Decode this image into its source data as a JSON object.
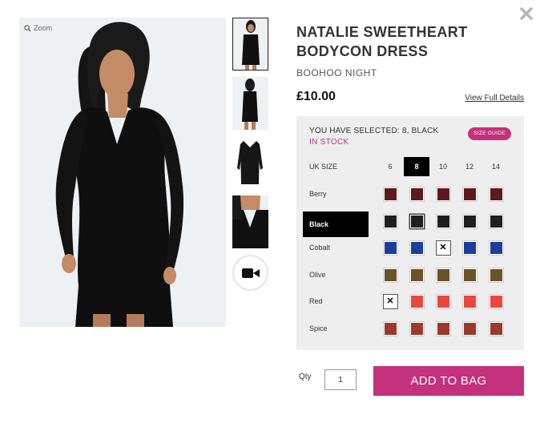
{
  "close_icon": "close-x-icon",
  "gallery": {
    "zoom_label": "Zoom",
    "zoom_icon": "magnifier-icon",
    "thumbnails": [
      "thumb-front",
      "thumb-back",
      "thumb-flat",
      "thumb-neckline"
    ],
    "video_icon": "video-camera-icon"
  },
  "product": {
    "title": "NATALIE SWEETHEART BODYCON DRESS",
    "brand": "BOOHOO NIGHT",
    "price": "£10.00",
    "view_full_details": "View Full Details"
  },
  "selector": {
    "selected_text": "YOU HAVE SELECTED: 8, BLACK",
    "stock_text": "IN STOCK",
    "size_guide": "SIZE GUIDE",
    "size_label": "UK SIZE",
    "sizes": [
      "6",
      "8",
      "10",
      "12",
      "14"
    ],
    "selected_size": "8",
    "selected_colour": "Black",
    "colours": [
      {
        "name": "Berry",
        "hex": "#5c1a1e",
        "unavailable_sizes": []
      },
      {
        "name": "Black",
        "hex": "#1f1f1f",
        "unavailable_sizes": []
      },
      {
        "name": "Cobalt",
        "hex": "#1c3d9a",
        "unavailable_sizes": [
          "10"
        ]
      },
      {
        "name": "Olive",
        "hex": "#6b5229",
        "unavailable_sizes": []
      },
      {
        "name": "Red",
        "hex": "#e8473f",
        "unavailable_sizes": [
          "6"
        ]
      },
      {
        "name": "Spice",
        "hex": "#9a3a2c",
        "unavailable_sizes": []
      }
    ]
  },
  "purchase": {
    "qty_label": "Qty",
    "qty_value": "1",
    "add_to_bag": "ADD TO BAG"
  },
  "colors": {
    "accent": "#c4317d",
    "panel_bg": "#eeeeee",
    "image_bg": "#edf1f4"
  }
}
